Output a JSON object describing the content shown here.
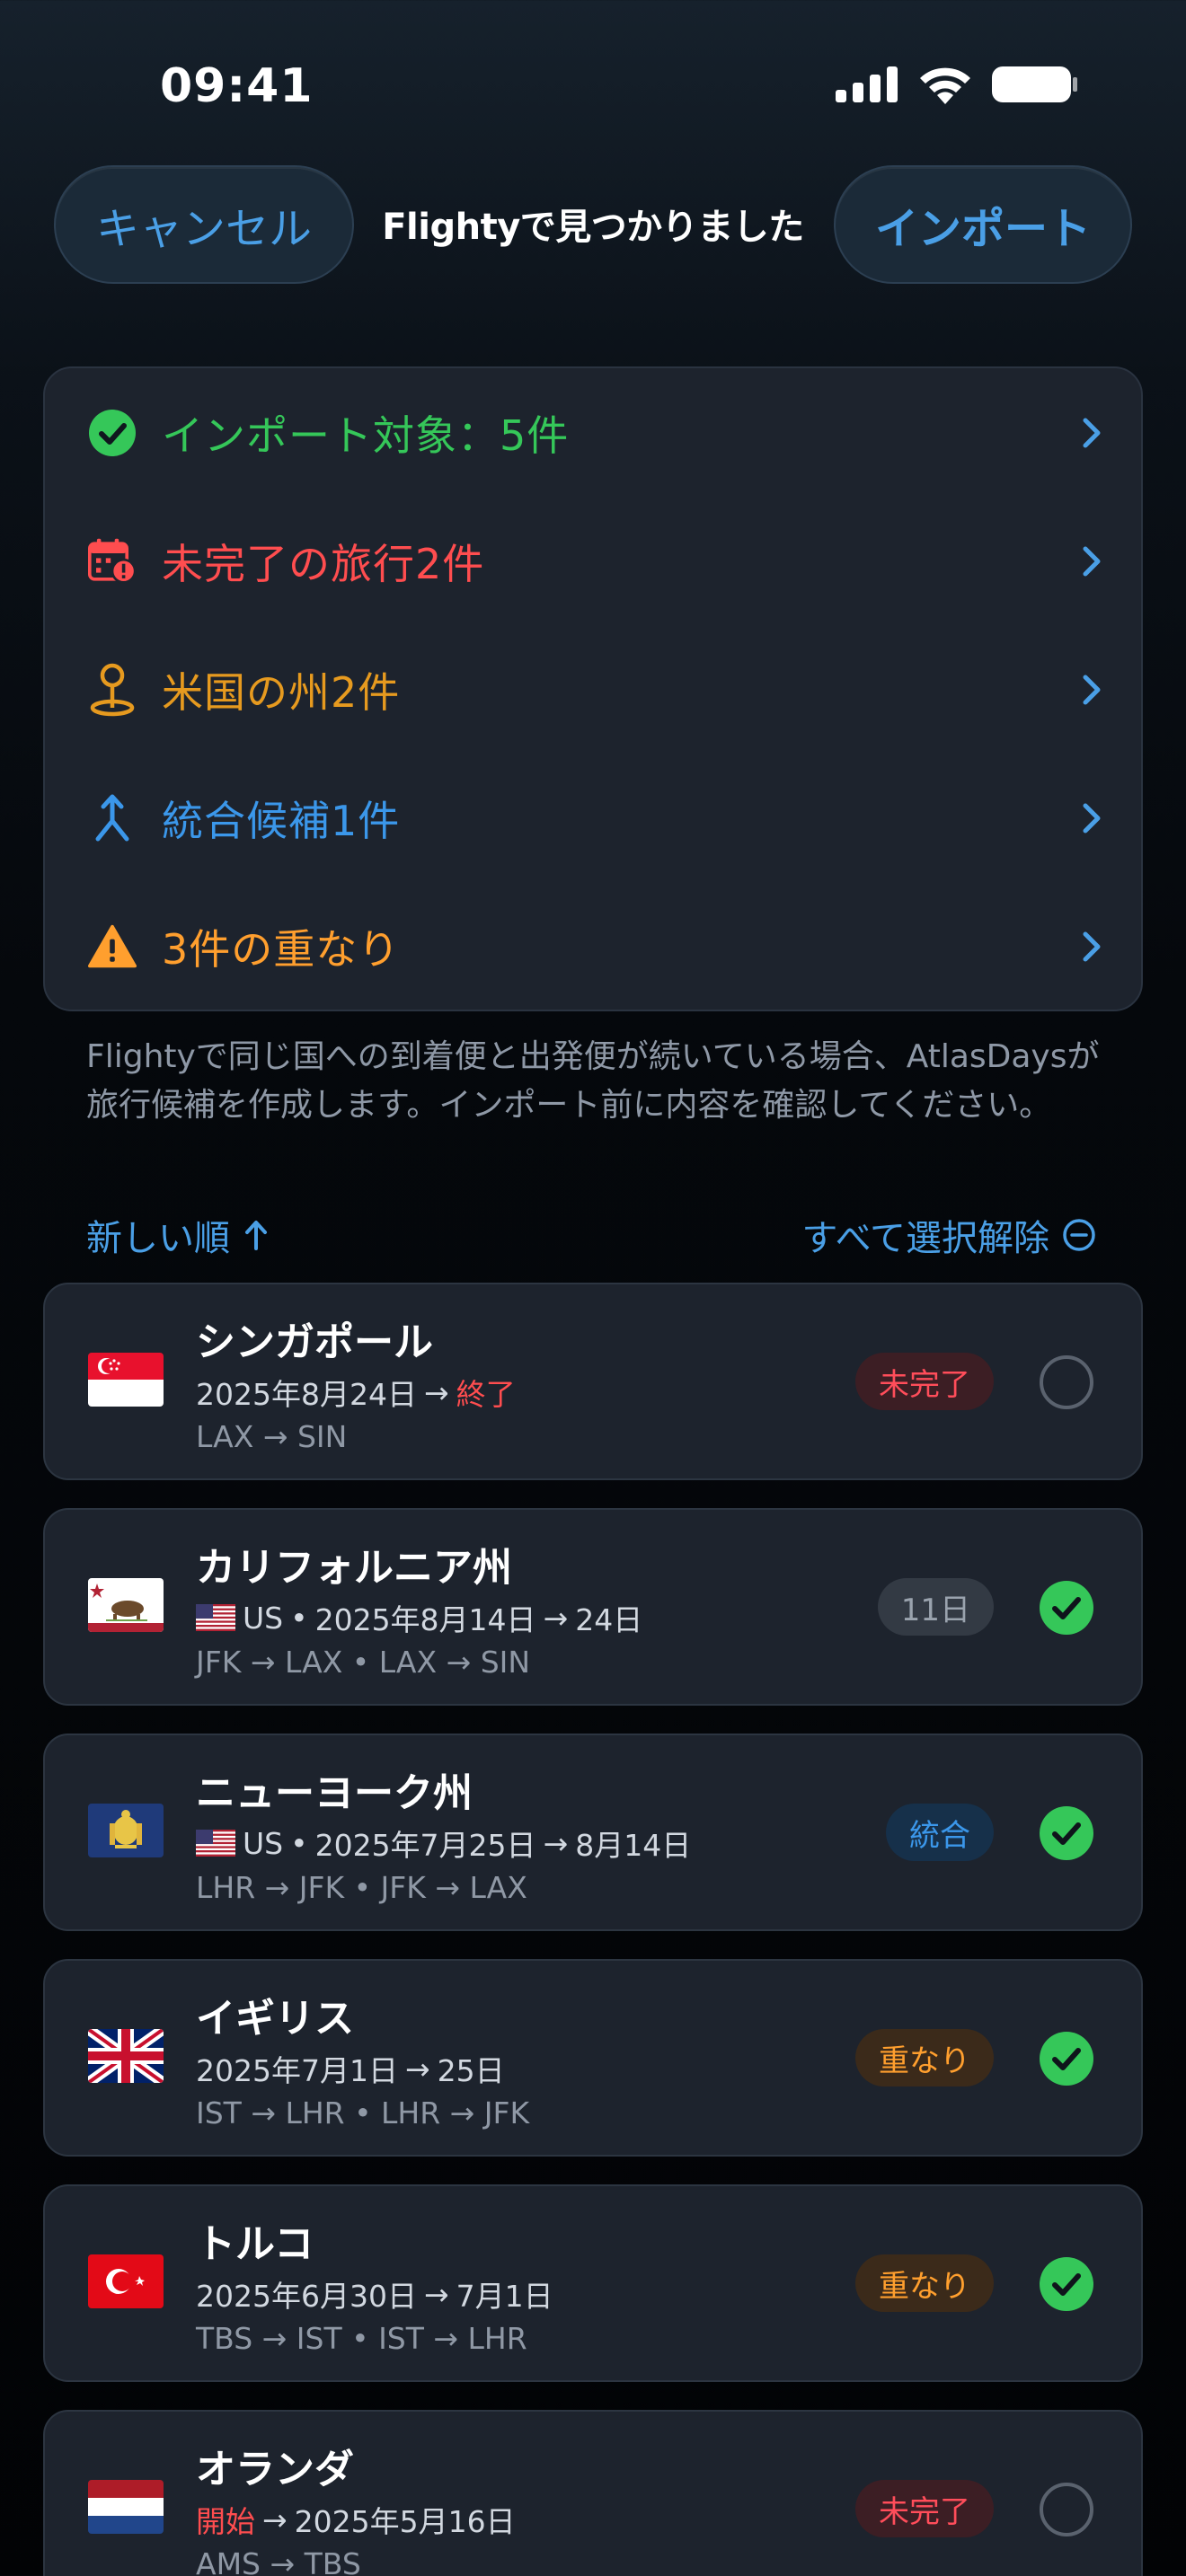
{
  "status_bar": {
    "time": "09:41"
  },
  "nav": {
    "cancel_label": "キャンセル",
    "title": "Flightyで見つかりました",
    "import_label": "インポート"
  },
  "summary": [
    {
      "label": "インポート対象：5件",
      "color": "#35c759",
      "icon": "checkmark-circle-icon"
    },
    {
      "label": "未完了の旅行2件",
      "color": "#ff4d4f",
      "icon": "calendar-alert-icon"
    },
    {
      "label": "米国の州2件",
      "color": "#e69a1f",
      "icon": "map-pin-icon"
    },
    {
      "label": "統合候補1件",
      "color": "#3b97ea",
      "icon": "merge-arrow-icon"
    },
    {
      "label": "3件の重なり",
      "color": "#ff9f2e",
      "icon": "warning-triangle-icon"
    }
  ],
  "note": "Flightyで同じ国への到着便と出発便が続いている場合、AtlasDaysが旅行候補を作成します。インポート前に内容を確認してください。",
  "list_header": {
    "sort_label": "新しい順",
    "deselect_label": "すべて選択解除"
  },
  "trips": [
    {
      "name": "シンガポール",
      "date_start": "2025年8月24日",
      "date_end": "終了",
      "route": "LAX → SIN",
      "badge": "未完了",
      "badge_bg": "#3c1e24",
      "badge_fg": "#ff4d5a",
      "selected": false,
      "flag": "singapore-flag"
    },
    {
      "name": "カリフォルニア州",
      "country": "US",
      "date_start": "2025年8月14日",
      "date_end": "24日",
      "route": "JFK → LAX • LAX → SIN",
      "badge": "11日",
      "badge_bg": "#333a44",
      "badge_fg": "#9aa3ae",
      "selected": true,
      "flag": "california-flag"
    },
    {
      "name": "ニューヨーク州",
      "country": "US",
      "date_start": "2025年7月25日",
      "date_end": "8月14日",
      "route": "LHR → JFK • JFK → LAX",
      "badge": "統合",
      "badge_bg": "#16304a",
      "badge_fg": "#3b97ea",
      "selected": true,
      "flag": "new-york-flag"
    },
    {
      "name": "イギリス",
      "date_start": "2025年7月1日",
      "date_end": "25日",
      "route": "IST → LHR • LHR → JFK",
      "badge": "重なり",
      "badge_bg": "#3b2a1a",
      "badge_fg": "#ff9f2e",
      "selected": true,
      "flag": "uk-flag"
    },
    {
      "name": "トルコ",
      "date_start": "2025年6月30日",
      "date_end": "7月1日",
      "route": "TBS → IST • IST → LHR",
      "badge": "重なり",
      "badge_bg": "#3b2a1a",
      "badge_fg": "#ff9f2e",
      "selected": true,
      "flag": "turkey-flag"
    },
    {
      "name": "オランダ",
      "date_start": "開始",
      "date_end": "2025年5月16日",
      "route": "AMS → TBS",
      "badge": "未完了",
      "badge_bg": "#3c1e24",
      "badge_fg": "#ff4d5a",
      "selected": false,
      "flag": "netherlands-flag"
    }
  ]
}
